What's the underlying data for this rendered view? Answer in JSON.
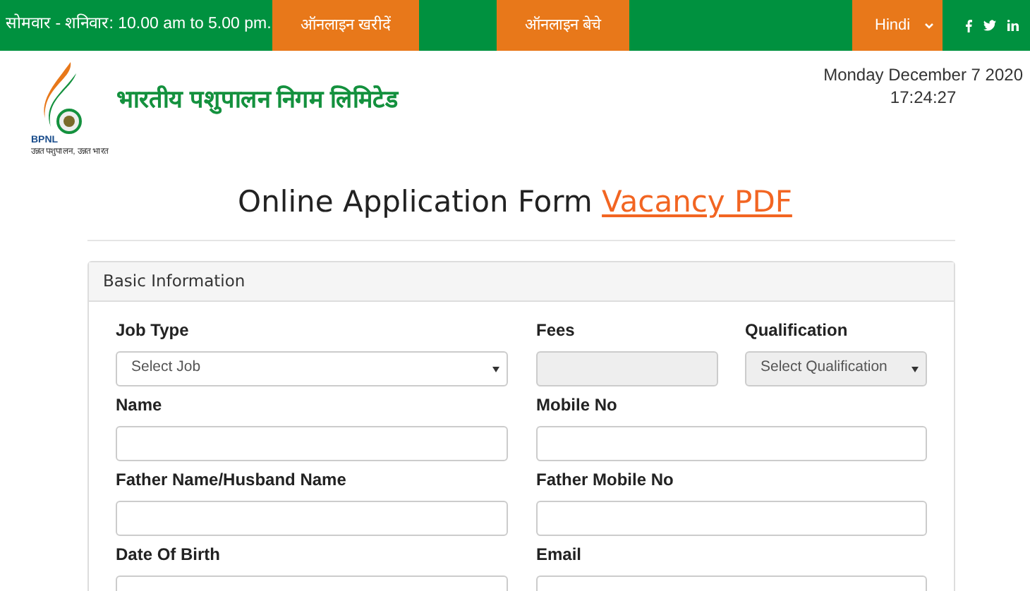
{
  "topbar": {
    "hours": "सोमवार - शनिवार: 10.00 am to 5.00 pm.",
    "links": [
      {
        "label": "ऑनलाइन खरीदें"
      },
      {
        "label": "ऑनलाइन बेचे"
      }
    ],
    "language": "Hindi"
  },
  "header": {
    "logo_badge": "BPNL",
    "logo_tagline": "उन्नत पशुपालन, उन्नत भारत",
    "org_name": "भारतीय पशुपालन निगम लिमिटेड",
    "date": "Monday December 7 2020",
    "time": "17:24:27"
  },
  "page_title": {
    "text": "Online Application Form",
    "link": "Vacancy PDF"
  },
  "form": {
    "title": "Basic Information",
    "rows": [
      [
        {
          "label": "Job Type",
          "kind": "select",
          "placeholder": "Select Job",
          "disabled": false
        },
        {
          "label": "Fees",
          "kind": "input",
          "disabled": true
        },
        {
          "label": "Qualification",
          "kind": "select",
          "placeholder": "Select Qualification",
          "disabled": true
        }
      ],
      [
        {
          "label": "Name",
          "kind": "input",
          "disabled": false
        },
        {
          "label": "Mobile No",
          "kind": "input",
          "disabled": false
        }
      ],
      [
        {
          "label": "Father Name/Husband Name",
          "kind": "input",
          "disabled": false
        },
        {
          "label": "Father Mobile No",
          "kind": "input",
          "disabled": false
        }
      ],
      [
        {
          "label": "Date Of Birth",
          "kind": "input",
          "disabled": false
        },
        {
          "label": "Email",
          "kind": "input",
          "disabled": false
        }
      ]
    ]
  }
}
